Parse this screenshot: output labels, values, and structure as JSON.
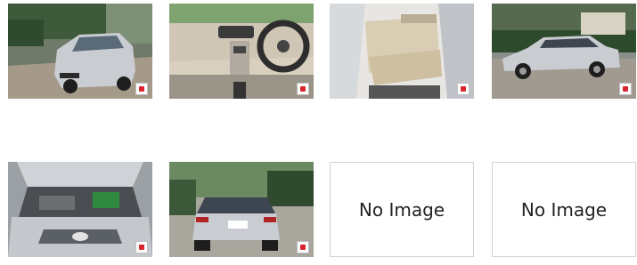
{
  "gallery": {
    "photos": [
      {
        "name": "front-three-quarter-photo",
        "icon": "zoom-badge-icon"
      },
      {
        "name": "dashboard-photo",
        "icon": "zoom-badge-icon"
      },
      {
        "name": "rear-seat-photo",
        "icon": "zoom-badge-icon"
      },
      {
        "name": "side-profile-photo",
        "icon": "zoom-badge-icon"
      },
      {
        "name": "engine-bay-photo",
        "icon": "zoom-badge-icon"
      },
      {
        "name": "rear-view-photo",
        "icon": "zoom-badge-icon"
      }
    ],
    "placeholders": [
      {
        "label": "No Image"
      },
      {
        "label": "No Image"
      }
    ],
    "colors": {
      "car_silver": "#c9ccd1",
      "badge_red": "#d8262c",
      "placeholder_border": "#d2d2d2"
    }
  }
}
